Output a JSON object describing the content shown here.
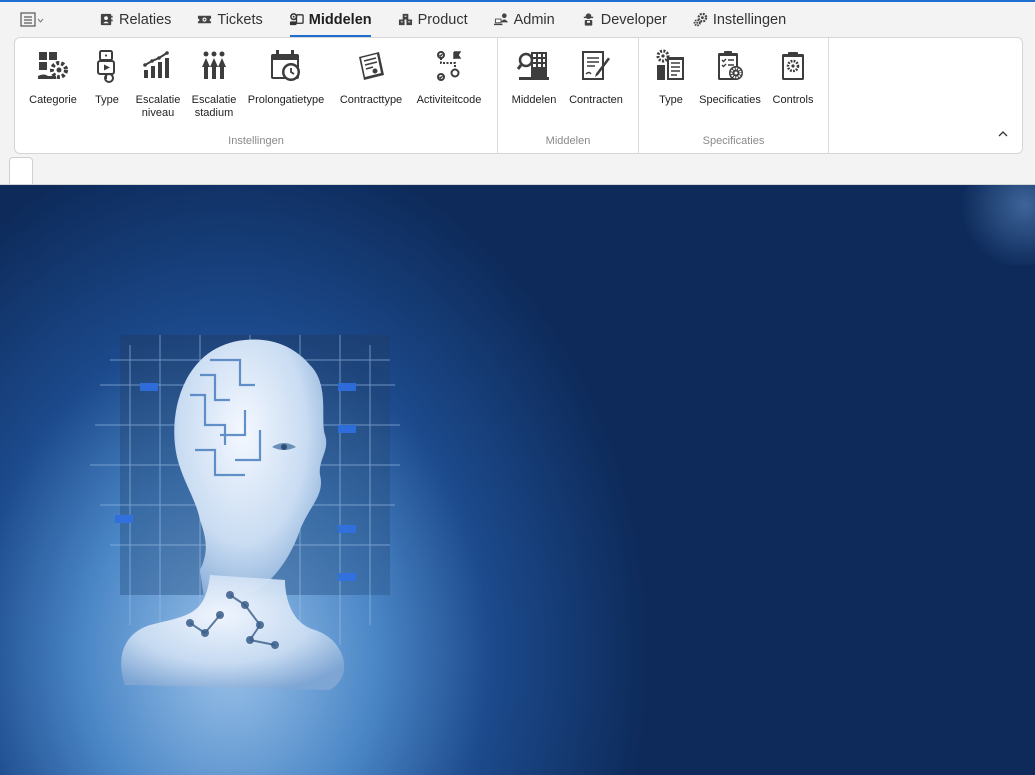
{
  "nav": {
    "tabs": [
      {
        "label": "Relaties",
        "icon": "contacts-icon",
        "active": false
      },
      {
        "label": "Tickets",
        "icon": "ticket-icon",
        "active": false
      },
      {
        "label": "Middelen",
        "icon": "assets-icon",
        "active": true
      },
      {
        "label": "Product",
        "icon": "product-icon",
        "active": false
      },
      {
        "label": "Admin",
        "icon": "admin-icon",
        "active": false
      },
      {
        "label": "Developer",
        "icon": "developer-icon",
        "active": false
      },
      {
        "label": "Instellingen",
        "icon": "settings-icon",
        "active": false
      }
    ]
  },
  "ribbon": {
    "groups": [
      {
        "title": "Instellingen",
        "buttons": [
          {
            "label": "Categorie",
            "icon": "category-gear-icon"
          },
          {
            "label": "Type",
            "icon": "type-icon"
          },
          {
            "label": "Escalatie\nniveau",
            "icon": "escalation-level-icon"
          },
          {
            "label": "Escalatie\nstadium",
            "icon": "escalation-stage-icon"
          },
          {
            "label": "Prolongatietype",
            "icon": "calendar-clock-icon"
          },
          {
            "label": "Contracttype",
            "icon": "contract-type-icon"
          },
          {
            "label": "Activiteitcode",
            "icon": "activity-code-icon"
          }
        ]
      },
      {
        "title": "Middelen",
        "buttons": [
          {
            "label": "Middelen",
            "icon": "assets-building-icon"
          },
          {
            "label": "Contracten",
            "icon": "contracts-icon"
          }
        ]
      },
      {
        "title": "Specificaties",
        "buttons": [
          {
            "label": "Type",
            "icon": "spec-type-icon"
          },
          {
            "label": "Specificaties",
            "icon": "specifications-icon"
          },
          {
            "label": "Controls",
            "icon": "controls-icon"
          }
        ]
      }
    ]
  },
  "colors": {
    "accent": "#1e6fd0",
    "hero_dark": "#0d2a5a",
    "hero_light": "#9cc3ea",
    "icon": "#3d3d3d"
  }
}
